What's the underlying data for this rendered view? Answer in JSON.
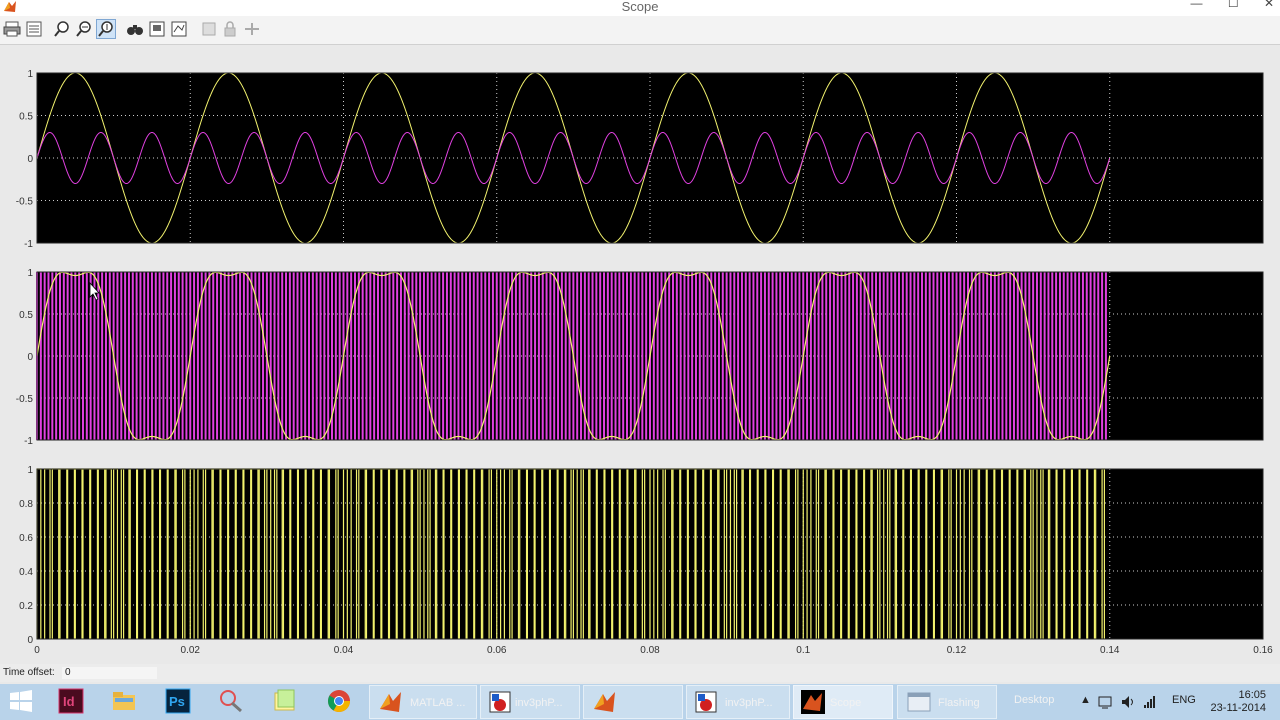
{
  "window": {
    "title": "Scope"
  },
  "toolbar": {
    "buttons": [
      "print-icon",
      "params-icon",
      "zoom-icon",
      "zoom-x-icon",
      "zoom-y-icon",
      "autoscale-icon",
      "save-axes-icon",
      "restore-axes-icon",
      "floating-icon",
      "lock-icon",
      "signal-select-icon"
    ]
  },
  "status": {
    "time_offset_label": "Time offset:",
    "time_offset_value": "0"
  },
  "taskbar": {
    "matlab_label": "MATLAB ...",
    "sim1_label": "inv3phP...",
    "sim2_label": "inv3phP...",
    "scope_label": "Scope",
    "flashing_label": "Flashing",
    "desktop_label": "Desktop",
    "lang": "ENG",
    "time": "16:05",
    "date": "23-11-2014"
  },
  "colors": {
    "yellow": "#f2f26e",
    "magenta": "#e040e0",
    "axes_bg": "#000000"
  },
  "chart_data": [
    {
      "type": "line",
      "title": "",
      "xlim": [
        0,
        0.16
      ],
      "ylim": [
        -1,
        1
      ],
      "yticks": [
        "1",
        "0.5",
        "0",
        "-0.5",
        "-1"
      ],
      "grid": true,
      "data_end_x": 0.14,
      "series": [
        {
          "color": "yellow",
          "frequency_hz": 50,
          "amplitude": 1,
          "phase": "sine"
        },
        {
          "color": "magenta",
          "frequency_hz": 150,
          "amplitude": 0.3,
          "phase": "sine"
        }
      ]
    },
    {
      "type": "line",
      "title": "",
      "xlim": [
        0,
        0.16
      ],
      "ylim": [
        -1,
        1
      ],
      "yticks": [
        "1",
        "0.5",
        "0",
        "-0.5",
        "-1"
      ],
      "grid": true,
      "data_end_x": 0.14,
      "series": [
        {
          "color": "yellow",
          "description_values": "sum of 50 Hz sine and 0.3 amplitude 150 Hz sine (flat-top)",
          "frequency_hz": 50
        },
        {
          "color": "magenta",
          "switching_frequency_hz": 1000,
          "ylim_swing": [
            -1,
            1
          ]
        }
      ]
    },
    {
      "type": "line",
      "title": "",
      "xlim": [
        0,
        0.16
      ],
      "ylim": [
        0,
        1
      ],
      "yticks": [
        "1",
        "0.8",
        "0.6",
        "0.4",
        "0.2",
        "0"
      ],
      "xticks": [
        "0",
        "0.02",
        "0.04",
        "0.06",
        "0.08",
        "0.1",
        "0.12",
        "0.14",
        "0.16"
      ],
      "grid": true,
      "data_end_x": 0.14,
      "series": [
        {
          "color": "yellow",
          "kind": "PWM pulses 0/1"
        }
      ]
    }
  ]
}
